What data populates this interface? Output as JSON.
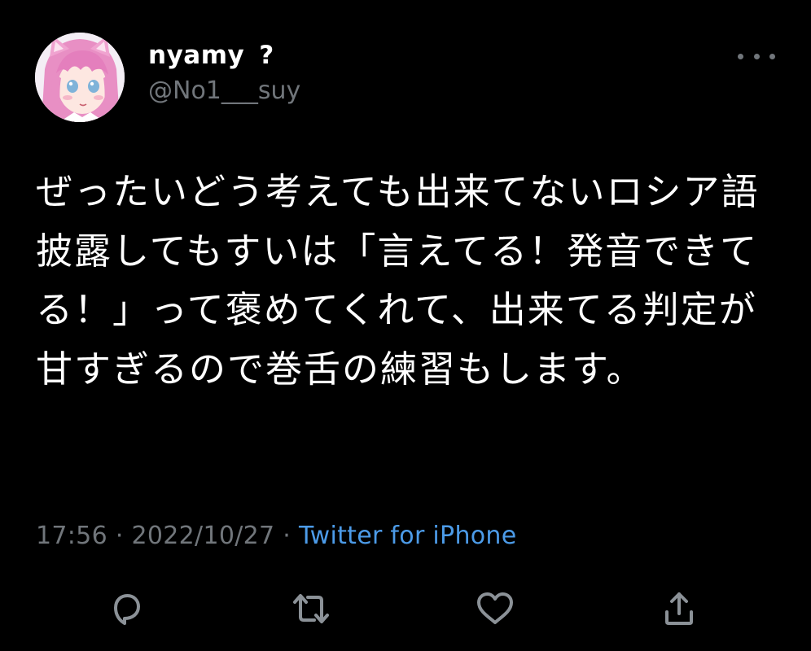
{
  "tweet": {
    "author": {
      "display_name": "nyamy",
      "badge": "?",
      "handle": "@No1___suy"
    },
    "text": "ぜったいどう考えても出来てないロシア語披露してもすいは「言えてる！発音できてる！」って褒めてくれて、出来てる判定が甘すぎるので巻舌の練習もします。",
    "time": "17:56",
    "date": "2022/10/27",
    "separator": "·",
    "source": "Twitter for iPhone"
  },
  "icons": {
    "more": "more-dots-icon",
    "reply": "reply-bubble-icon",
    "retweet": "retweet-icon",
    "like": "heart-icon",
    "share": "share-icon"
  },
  "colors": {
    "background": "#000000",
    "text_primary": "#ffffff",
    "text_secondary": "#71767b",
    "link": "#4c9be8",
    "icon": "#8b9197"
  }
}
